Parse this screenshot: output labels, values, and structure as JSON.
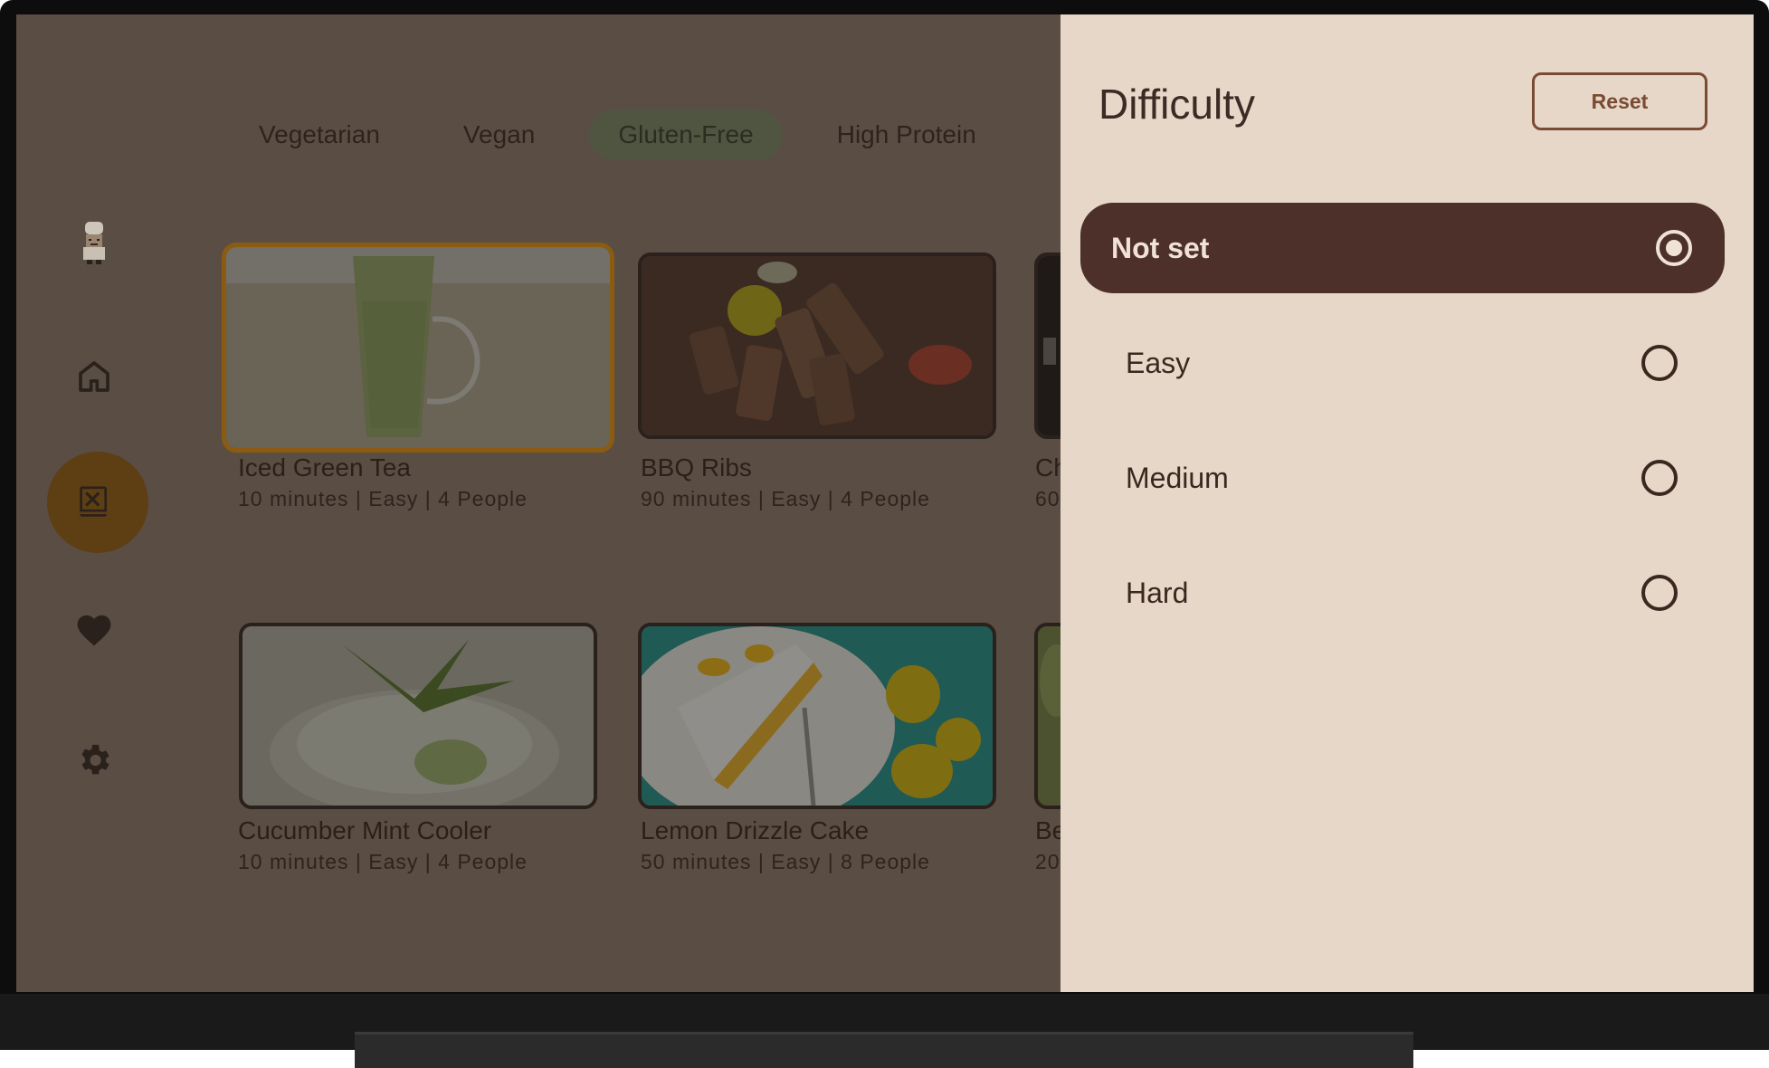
{
  "filter_chips": [
    "Vegetarian",
    "Vegan",
    "Gluten-Free",
    "High Protein"
  ],
  "active_chip": "Gluten-Free",
  "rail": {
    "items": [
      "chef-avatar",
      "home-icon",
      "recipe-book-icon",
      "heart-icon",
      "gear-icon"
    ],
    "selected": "recipe-book-icon"
  },
  "recipes": [
    {
      "title": "Iced Green Tea",
      "subtitle": "10 minutes | Easy | 4 People"
    },
    {
      "title": "BBQ Ribs",
      "subtitle": "90 minutes | Easy | 4 People"
    },
    {
      "title": "Ch",
      "subtitle": "60"
    },
    {
      "title": "Cucumber Mint Cooler",
      "subtitle": "10 minutes | Easy | 4 People"
    },
    {
      "title": "Lemon Drizzle Cake",
      "subtitle": "50 minutes | Easy | 8 People"
    },
    {
      "title": "Be",
      "subtitle": "20"
    }
  ],
  "drawer": {
    "title": "Difficulty",
    "reset_label": "Reset",
    "options": [
      {
        "label": "Not set",
        "selected": true
      },
      {
        "label": "Easy",
        "selected": false
      },
      {
        "label": "Medium",
        "selected": false
      },
      {
        "label": "Hard",
        "selected": false
      }
    ]
  },
  "colors": {
    "scrim_background": "#5a4d44",
    "drawer_background": "#e6d7c8",
    "selected_option": "#4e302b",
    "reset_border": "#7a4a32",
    "focused_card_border": "#8a5b10",
    "active_chip": "#4f5541"
  }
}
